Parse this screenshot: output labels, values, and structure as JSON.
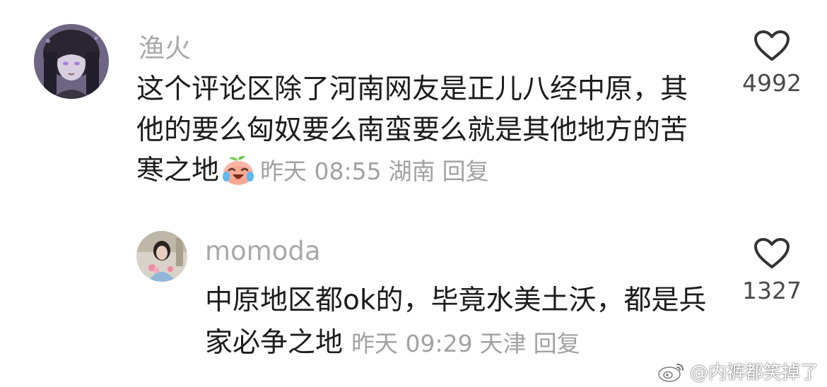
{
  "comment": {
    "author": "渔火",
    "text_main": "这个评论区除了河南网友是正儿八经中原，其他的要么匈奴要么南蛮要么就是其他地方的苦寒之地",
    "emoji": "crying-laughing-peach-emoji",
    "time": "昨天 08:55",
    "location": "湖南",
    "reply_label": "回复",
    "like_count": "4992",
    "like_icon": "heart-outline-icon"
  },
  "reply": {
    "author": "momoda",
    "text_main": "中原地区都ok的，毕竟水美土沃，都是兵家必争之地",
    "time": "昨天 09:29",
    "location": "天津",
    "reply_label": "回复",
    "like_count": "1327",
    "like_icon": "heart-outline-icon"
  },
  "watermark": {
    "text": "@内裤都笑掉了",
    "icon": "weibo-logo-icon"
  }
}
